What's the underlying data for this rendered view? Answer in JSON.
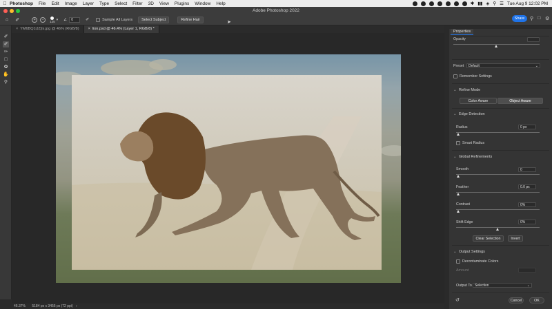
{
  "menubar": {
    "app_name": "Photoshop",
    "items": [
      "File",
      "Edit",
      "Image",
      "Layer",
      "Type",
      "Select",
      "Filter",
      "3D",
      "View",
      "Plugins",
      "Window",
      "Help"
    ],
    "clock": "Tue Aug 9  12:02 PM"
  },
  "window": {
    "title": "Adobe Photoshop 2022",
    "share_label": "Share"
  },
  "options_bar": {
    "brush_size": "125",
    "angle_value": "0",
    "sample_all_layers_label": "Sample All Layers",
    "select_subject_label": "Select Subject",
    "refine_hair_label": "Refine Hair"
  },
  "tabs": [
    {
      "label": "YM6BQ1iJZjIs.jpg @ 46% (RGB/8)"
    },
    {
      "label": "lion.psd @ 46.4% (Layer 1, RGB/8) *"
    }
  ],
  "status": {
    "zoom": "46.37%",
    "doc_info": "5184 px x 3456 px (72 ppi)"
  },
  "properties": {
    "tab_label": "Properties",
    "opacity_label": "Opacity",
    "opacity_level": 0.5,
    "preset_label": "Preset",
    "preset_value": "Default",
    "remember_settings_label": "Remember Settings",
    "refine_mode_title": "Refine Mode",
    "color_aware_label": "Color Aware",
    "object_aware_label": "Object Aware",
    "edge_detection_title": "Edge Detection",
    "radius_label": "Radius",
    "radius_value": "0 px",
    "smart_radius_label": "Smart Radius",
    "global_refinements_title": "Global Refinements",
    "smooth_label": "Smooth",
    "smooth_value": "0",
    "feather_label": "Feather",
    "feather_value": "0.0 px",
    "contrast_label": "Contrast",
    "contrast_value": "0%",
    "shift_edge_label": "Shift Edge",
    "shift_edge_value": "0%",
    "clear_selection_label": "Clear Selection",
    "invert_label": "Invert",
    "output_settings_title": "Output Settings",
    "decontaminate_label": "Decontaminate Colors",
    "amount_label": "Amount",
    "output_to_label": "Output To",
    "output_to_value": "Selection",
    "cancel_label": "Cancel",
    "ok_label": "OK"
  },
  "colors": {
    "accent": "#1f73e8",
    "panel_bg": "#343434",
    "canvas_bg": "#282828"
  }
}
